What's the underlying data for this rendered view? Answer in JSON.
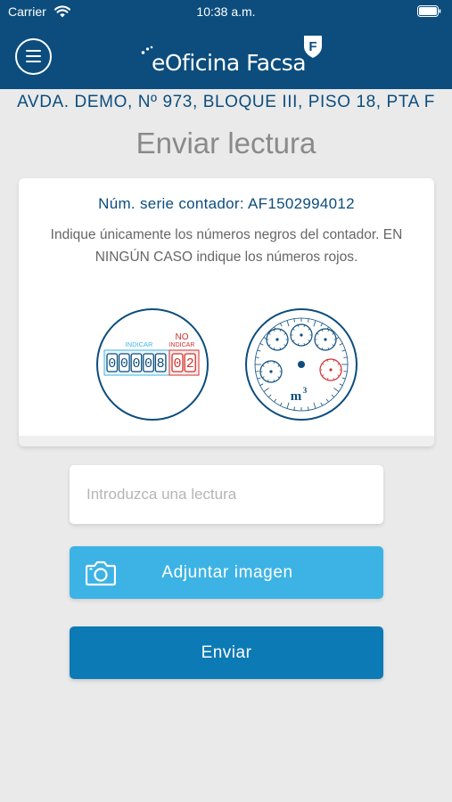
{
  "status_bar": {
    "carrier": "Carrier",
    "time": "10:38 a.m."
  },
  "header": {
    "brand": "eOficina Facsa",
    "badge_letter": "F"
  },
  "address": "AVDA. DEMO, Nº 973, BLOQUE III, PISO 18, PTA F",
  "page_title": "Enviar lectura",
  "meter_card": {
    "serial_label": "Núm. serie contador: AF1502994012",
    "instruction": "Indique únicamente los números negros del contador. EN NINGÚN CASO indique los números rojos.",
    "digital_meter": {
      "indicate_label": "INDICAR",
      "no_indicate_label_1": "NO",
      "no_indicate_label_2": "INDICAR",
      "black_digits": [
        "0",
        "0",
        "0",
        "0",
        "8"
      ],
      "red_digits": [
        "0",
        "2"
      ]
    },
    "dial_meter": {
      "unit_label": "m",
      "unit_exponent": "3"
    }
  },
  "reading_input": {
    "placeholder": "Introduzca una lectura",
    "value": ""
  },
  "attach_button": {
    "label": "Adjuntar imagen",
    "icon": "camera-icon"
  },
  "submit_button": {
    "label": "Enviar"
  },
  "colors": {
    "header_bg": "#0c4d7d",
    "primary_text": "#0c4d7d",
    "attach_bg": "#3db3e5",
    "submit_bg": "#0c7ab4",
    "red_digits": "#d0312d"
  }
}
